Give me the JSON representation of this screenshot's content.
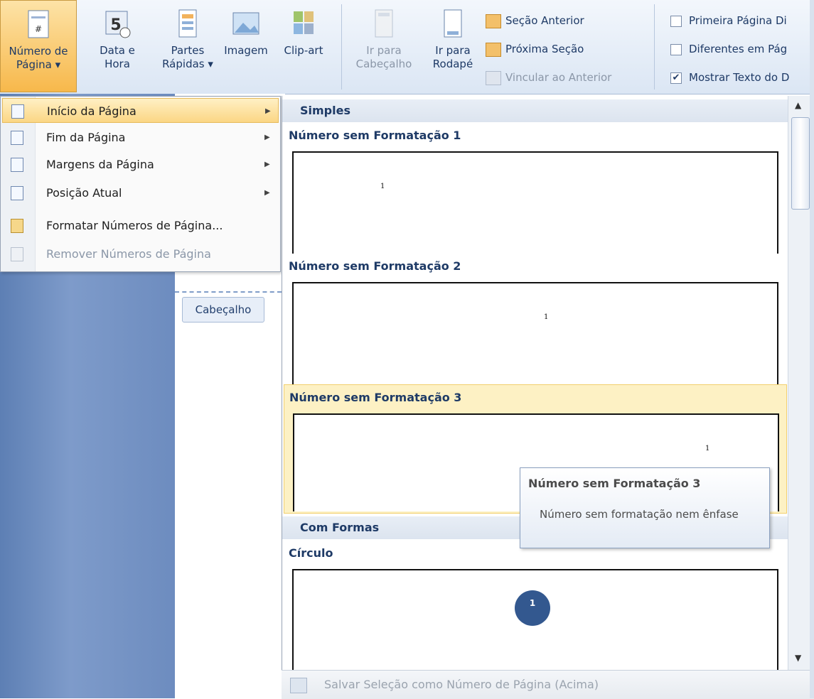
{
  "ribbon": {
    "numero_pagina": {
      "line1": "Número de",
      "line2": "Página ▾"
    },
    "data_hora": {
      "line1": "Data e",
      "line2": "Hora"
    },
    "partes_rapidas": {
      "line1": "Partes",
      "line2": "Rápidas ▾"
    },
    "imagem": {
      "label": "Imagem"
    },
    "clipart": {
      "label": "Clip-art"
    },
    "ir_cabecalho": {
      "line1": "Ir para",
      "line2": "Cabeçalho"
    },
    "ir_rodape": {
      "line1": "Ir para",
      "line2": "Rodapé"
    },
    "secao_anterior": "Seção Anterior",
    "proxima_secao": "Próxima Seção",
    "vincular_anterior": "Vincular ao Anterior",
    "primeira_pagina": "Primeira Página Di",
    "diferentes_pag": "Diferentes em Pág",
    "mostrar_texto": "Mostrar Texto do D",
    "mostrar_texto_checked": "✔"
  },
  "menu": {
    "items": [
      {
        "label": "Início da Página"
      },
      {
        "label": "Fim da Página"
      },
      {
        "label": "Margens da Página"
      },
      {
        "label": "Posição Atual"
      },
      {
        "label": "Formatar Números de Página..."
      },
      {
        "label": "Remover Números de Página"
      }
    ]
  },
  "document": {
    "header_tag": "Cabeçalho"
  },
  "gallery": {
    "section_simples": "Simples",
    "section_com_formas": "Com Formas",
    "items": [
      {
        "title": "Número sem Formatação 1",
        "number": "1"
      },
      {
        "title": "Número sem Formatação 2",
        "number": "1"
      },
      {
        "title": "Número sem Formatação 3",
        "number": "1"
      },
      {
        "title": "Círculo",
        "number": "1"
      }
    ],
    "footer": "Salvar Seleção como Número de Página (Acima)"
  },
  "tooltip": {
    "title": "Número sem Formatação 3",
    "description": "Número sem formatação nem ênfase"
  },
  "colors": {
    "accent": "#f7b84b",
    "circle": "#33588f"
  }
}
